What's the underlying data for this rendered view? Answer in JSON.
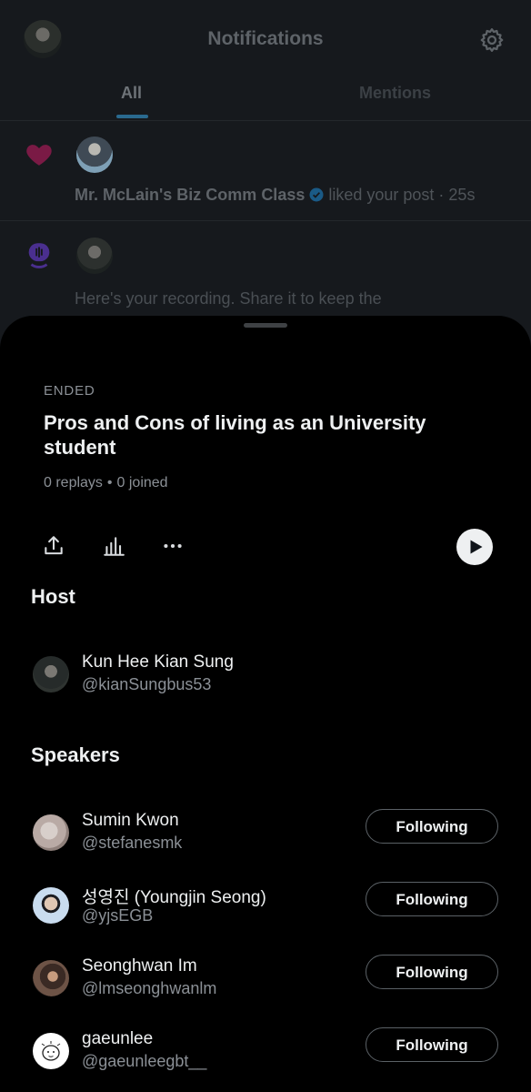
{
  "header": {
    "title": "Notifications",
    "tabs": [
      {
        "label": "All",
        "active": true
      },
      {
        "label": "Mentions",
        "active": false
      }
    ]
  },
  "notifications": [
    {
      "icon": "heart-icon",
      "user": "Mr. McLain's Biz Comm Class",
      "verified": true,
      "action": "liked your post",
      "time": "25s"
    },
    {
      "icon": "microphone-icon",
      "text_line1": "Here's your recording. Share it to keep the"
    }
  ],
  "space": {
    "status": "ENDED",
    "title": "Pros and Cons of living as an University student",
    "replays": "0 replays",
    "joined": "0 joined",
    "separator": "•"
  },
  "host": {
    "heading": "Host",
    "name": "Kun Hee Kian Sung",
    "handle": "@kianSungbus53"
  },
  "speakers": {
    "heading": "Speakers",
    "items": [
      {
        "name": "Sumin Kwon",
        "handle": "@stefanesmk",
        "button": "Following"
      },
      {
        "name": "성영진 (Youngjin Seong)",
        "handle": "@yjsEGB",
        "button": "Following"
      },
      {
        "name": "Seonghwan Im",
        "handle": "@lmseonghwanlm",
        "button": "Following"
      },
      {
        "name": "gaeunlee",
        "handle": "@gaeunleegbt__",
        "button": "Following"
      }
    ]
  },
  "colors": {
    "accent": "#1d9bf0",
    "heart": "#f91880",
    "spaces_purple": "#7856ff",
    "sheet_background": "#000000"
  }
}
